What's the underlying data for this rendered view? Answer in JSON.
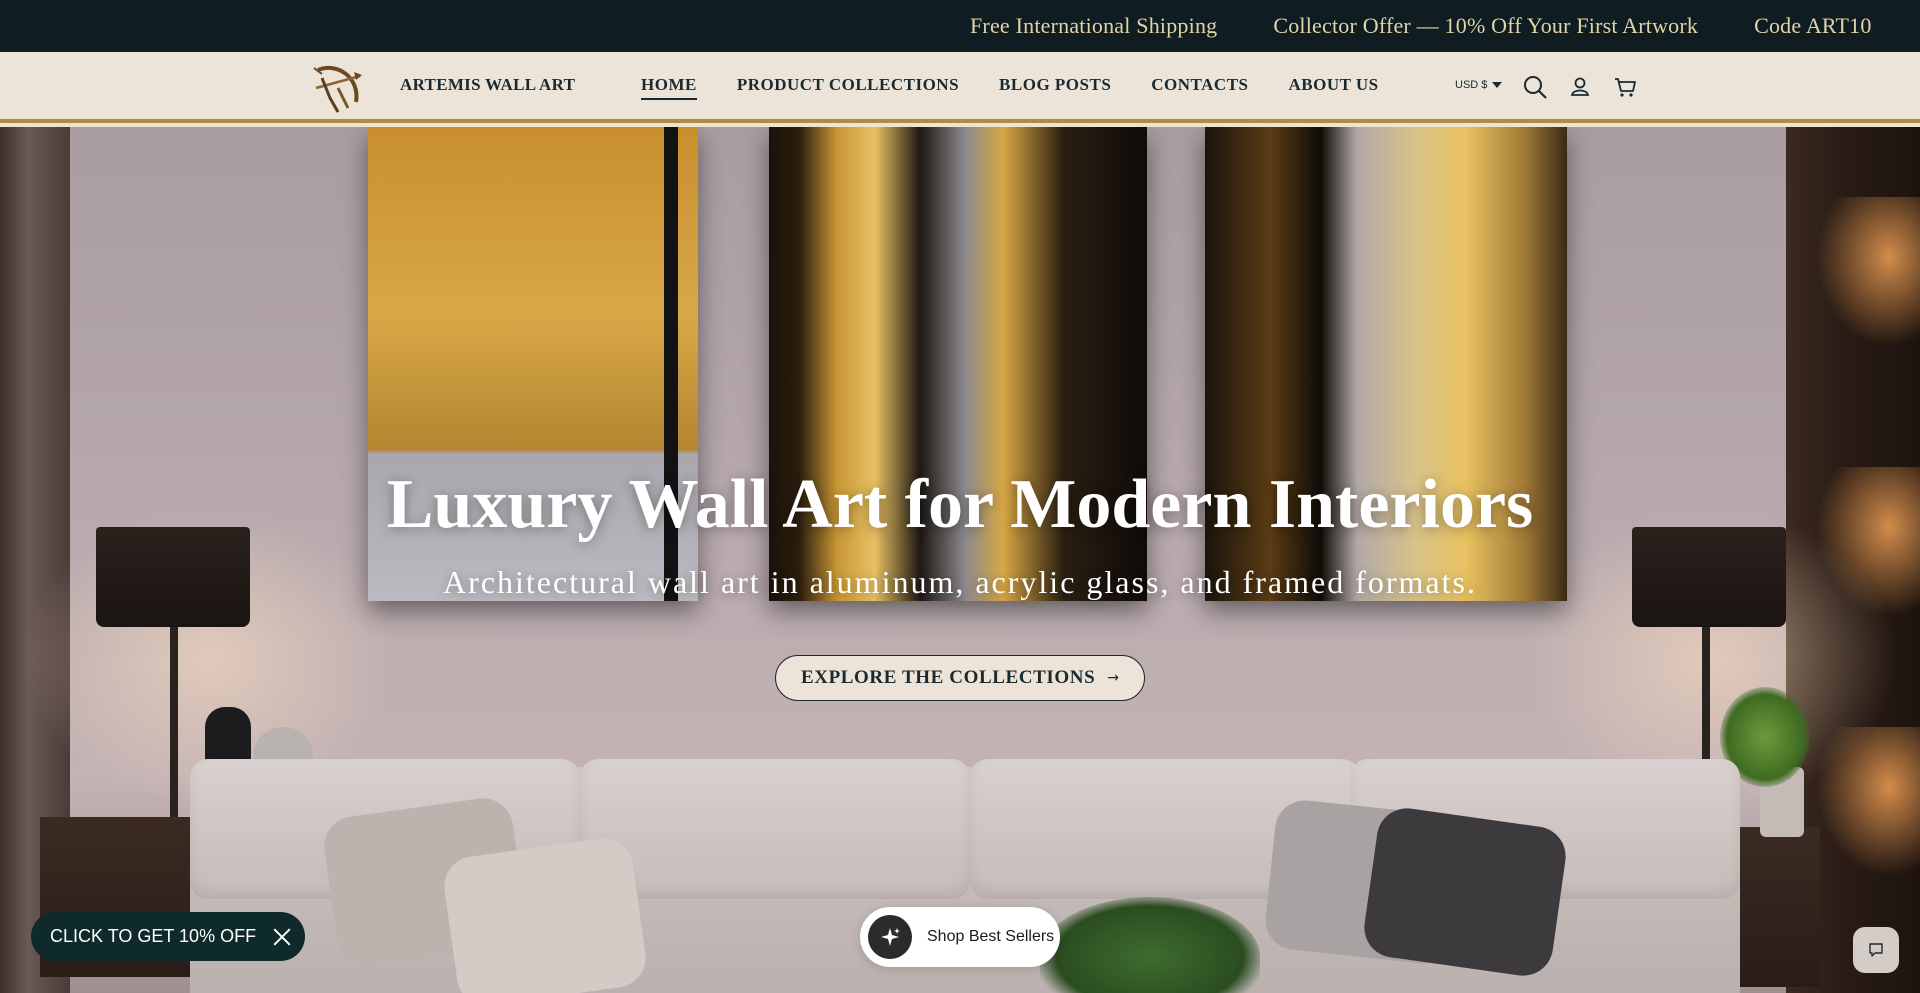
{
  "announcement": {
    "messages": [
      "Free International Shipping",
      "Collector Offer — 10% Off Your First Artwork",
      "Code ART10"
    ]
  },
  "header": {
    "brand": "ARTEMIS WALL ART",
    "nav": [
      {
        "label": "HOME",
        "active": true
      },
      {
        "label": "PRODUCT COLLECTIONS",
        "active": false
      },
      {
        "label": "BLOG POSTS",
        "active": false
      },
      {
        "label": "CONTACTS",
        "active": false
      },
      {
        "label": "ABOUT US",
        "active": false
      }
    ],
    "currency": "USD $",
    "icons": [
      "search-icon",
      "account-icon",
      "cart-icon"
    ]
  },
  "hero": {
    "title": "Luxury Wall Art for Modern Interiors",
    "subtitle": "Architectural wall art in aluminum, acrylic glass, and framed formats.",
    "cta_label": "EXPLORE THE COLLECTIONS",
    "cta_arrow": "→"
  },
  "widgets": {
    "promo_label": "CLICK TO GET 10% OFF",
    "bestsellers_label": "Shop Best Sellers"
  },
  "colors": {
    "announcement_bg": "#0f1c22",
    "announcement_text": "#e3d4a8",
    "header_bg": "#ece4d9",
    "accent_gold": "#b08d3e",
    "text_dark": "#1a2a2e",
    "promo_bg": "#0f2a2a"
  }
}
